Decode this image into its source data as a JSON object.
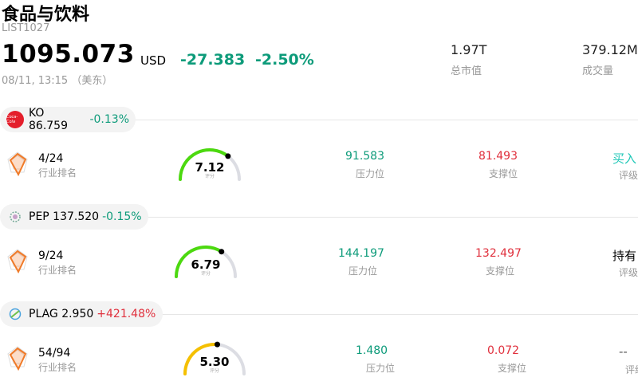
{
  "header": {
    "title": "食品与饮料",
    "code": "LIST1027",
    "price": "1095.073",
    "currency": "USD",
    "change": "-27.383",
    "change_pct": "-2.50%",
    "time": "08/11, 13:15 （美东）"
  },
  "stats": [
    {
      "value": "1.97T",
      "label": "总市值"
    },
    {
      "value": "379.12M",
      "label": "成交量"
    }
  ],
  "stocks": [
    {
      "ticker": "KO",
      "price": "86.759",
      "change_pct": "-0.13%",
      "logo": "coca-cola-logo",
      "logo_text": "Coca-Cola",
      "rank": "4/24",
      "rank_label": "行业排名",
      "score": "7.12",
      "score_label": "评分",
      "score_fraction": 0.712,
      "gauge_color": "#4cd90f",
      "resistance": "91.583",
      "resistance_label": "压力位",
      "support": "81.493",
      "support_label": "支撑位",
      "rating": "买入",
      "rating_label": "评级",
      "rating_color": "#1fc7b7"
    },
    {
      "ticker": "PEP",
      "price": "137.520",
      "change_pct": "-0.15%",
      "logo": "pepsico-logo",
      "logo_text": "",
      "rank": "9/24",
      "rank_label": "行业排名",
      "score": "6.79",
      "score_label": "评分",
      "score_fraction": 0.679,
      "gauge_color": "#4cd90f",
      "resistance": "144.197",
      "resistance_label": "压力位",
      "support": "132.497",
      "support_label": "支撑位",
      "rating": "持有",
      "rating_label": "评级",
      "rating_color": "#000000"
    },
    {
      "ticker": "PLAG",
      "price": "2.950",
      "change_pct": "+421.48%",
      "logo": "plag-logo",
      "logo_text": "",
      "rank": "54/94",
      "rank_label": "行业排名",
      "score": "5.30",
      "score_label": "评分",
      "score_fraction": 0.53,
      "gauge_color": "#f5c000",
      "resistance": "1.480",
      "resistance_label": "压力位",
      "support": "0.072",
      "support_label": "支撑位",
      "rating": "--",
      "rating_label": "评级",
      "rating_color": "#555555"
    }
  ],
  "colors": {
    "down": "#0d9b7a",
    "up": "#e0303d",
    "support": "#e0303d"
  }
}
